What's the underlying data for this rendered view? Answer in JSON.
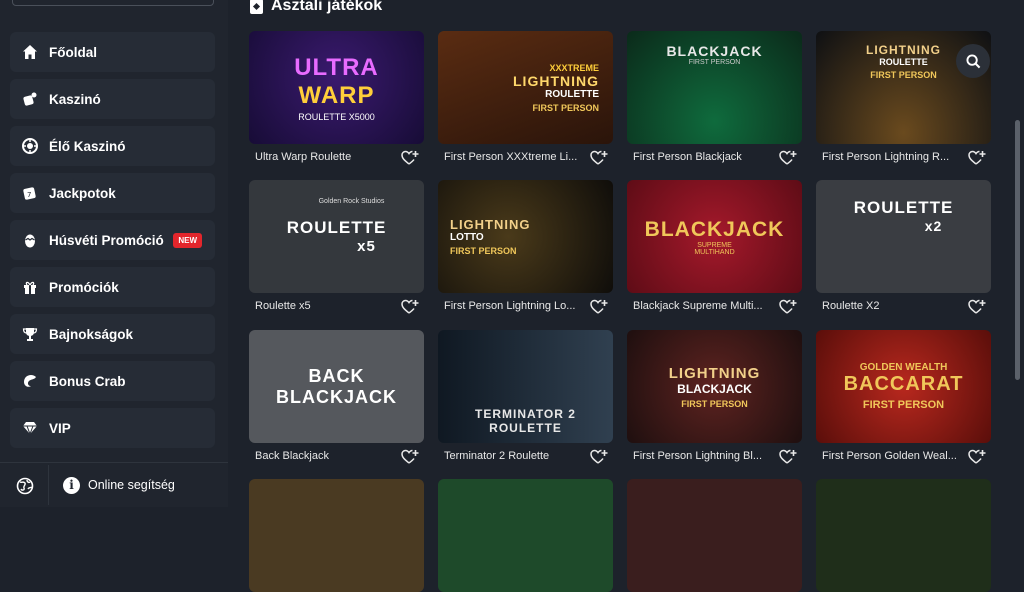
{
  "sidebar": {
    "items": [
      {
        "label": "Főoldal",
        "icon": "home-icon"
      },
      {
        "label": "Kaszinó",
        "icon": "dice-icon"
      },
      {
        "label": "Élő Kaszinó",
        "icon": "roulette-wheel-icon"
      },
      {
        "label": "Jackpotok",
        "icon": "slot-machine-icon"
      },
      {
        "label": "Húsvéti Promóció",
        "icon": "easter-egg-icon",
        "badge": "NEW"
      },
      {
        "label": "Promóciók",
        "icon": "gift-icon"
      },
      {
        "label": "Bajnokságok",
        "icon": "trophy-icon"
      },
      {
        "label": "Bonus Crab",
        "icon": "crab-claw-icon"
      },
      {
        "label": "VIP",
        "icon": "diamond-icon"
      }
    ],
    "help_label": "Online segítség"
  },
  "main": {
    "section_title": "Asztali játékok",
    "games": [
      {
        "name": "Ultra Warp Roulette",
        "art": [
          "ULTRA",
          "WARP",
          "ROULETTE X5000"
        ]
      },
      {
        "name": "First Person XXXtreme Li...",
        "art": [
          "XXXTREME",
          "LIGHTNING",
          "ROULETTE",
          "FIRST PERSON"
        ]
      },
      {
        "name": "First Person Blackjack",
        "art": [
          "BLACKJACK",
          "FIRST PERSON"
        ]
      },
      {
        "name": "First Person Lightning R...",
        "art": [
          "LIGHTNING",
          "ROULETTE",
          "FIRST PERSON"
        ]
      },
      {
        "name": "Roulette x5",
        "art": [
          "ROULETTE",
          "x5",
          "Golden Rock Studios"
        ]
      },
      {
        "name": "First Person Lightning Lo...",
        "art": [
          "LIGHTNING",
          "LOTTO",
          "FIRST PERSON"
        ]
      },
      {
        "name": "Blackjack Supreme Multi...",
        "art": [
          "BLACKJACK",
          "SUPREME",
          "MULTIHAND"
        ]
      },
      {
        "name": "Roulette X2",
        "art": [
          "ROULETTE",
          "x2"
        ]
      },
      {
        "name": "Back Blackjack",
        "art": [
          "BACK",
          "BLACKJACK"
        ]
      },
      {
        "name": "Terminator 2 Roulette",
        "art": [
          "TERMINATOR 2",
          "ROULETTE"
        ]
      },
      {
        "name": "First Person Lightning Bl...",
        "art": [
          "LIGHTNING",
          "BLACKJACK",
          "FIRST PERSON"
        ]
      },
      {
        "name": "First Person Golden Weal...",
        "art": [
          "GOLDEN WEALTH",
          "BACCARAT",
          "FIRST PERSON"
        ]
      }
    ]
  },
  "colors": {
    "background": "#1d222b",
    "sidebar": "#20252e",
    "nav_item": "#262c36",
    "badge": "#e3262c"
  }
}
